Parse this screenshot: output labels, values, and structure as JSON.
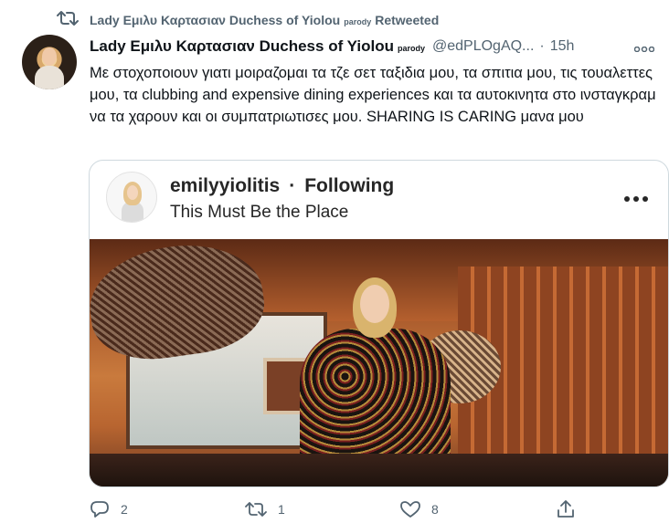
{
  "retweet": {
    "name": "Lady Εμιλυ Καρτασιαν Duchess of Yiolou",
    "badge": "parody",
    "suffix": "Retweeted"
  },
  "tweet": {
    "name": "Lady Εμιλυ Καρτασιαν Duchess of Yiolou",
    "badge": "parody",
    "handle": "@edPLOgAQ...",
    "separator": "·",
    "time": "15h",
    "text": "Με στοχοποιουν γιατι μοιραζομαι τα τζε σετ ταξιδια μου, τα σπιτια μου, τις τουαλεττες μου, τα clubbing and expensive dining experiences και τα αυτοκινητα στο ινσταγκραμ να τα χαρουν και οι συμπατριωτισες μου. SHARING IS CARING μανα μου"
  },
  "card": {
    "username": "emilyyiolitis",
    "separator": "·",
    "follow_state": "Following",
    "location": "This Must Be the Place"
  },
  "actions": {
    "reply_count": "2",
    "retweet_count": "1",
    "like_count": "8"
  },
  "icons": {
    "retweet": "retweet-icon",
    "more": "more-icon",
    "reply": "reply-icon",
    "like": "heart-icon",
    "share": "share-icon"
  },
  "colors": {
    "secondary_text": "#536471",
    "primary_text": "#0f1419",
    "card_border": "#cfd9de"
  }
}
